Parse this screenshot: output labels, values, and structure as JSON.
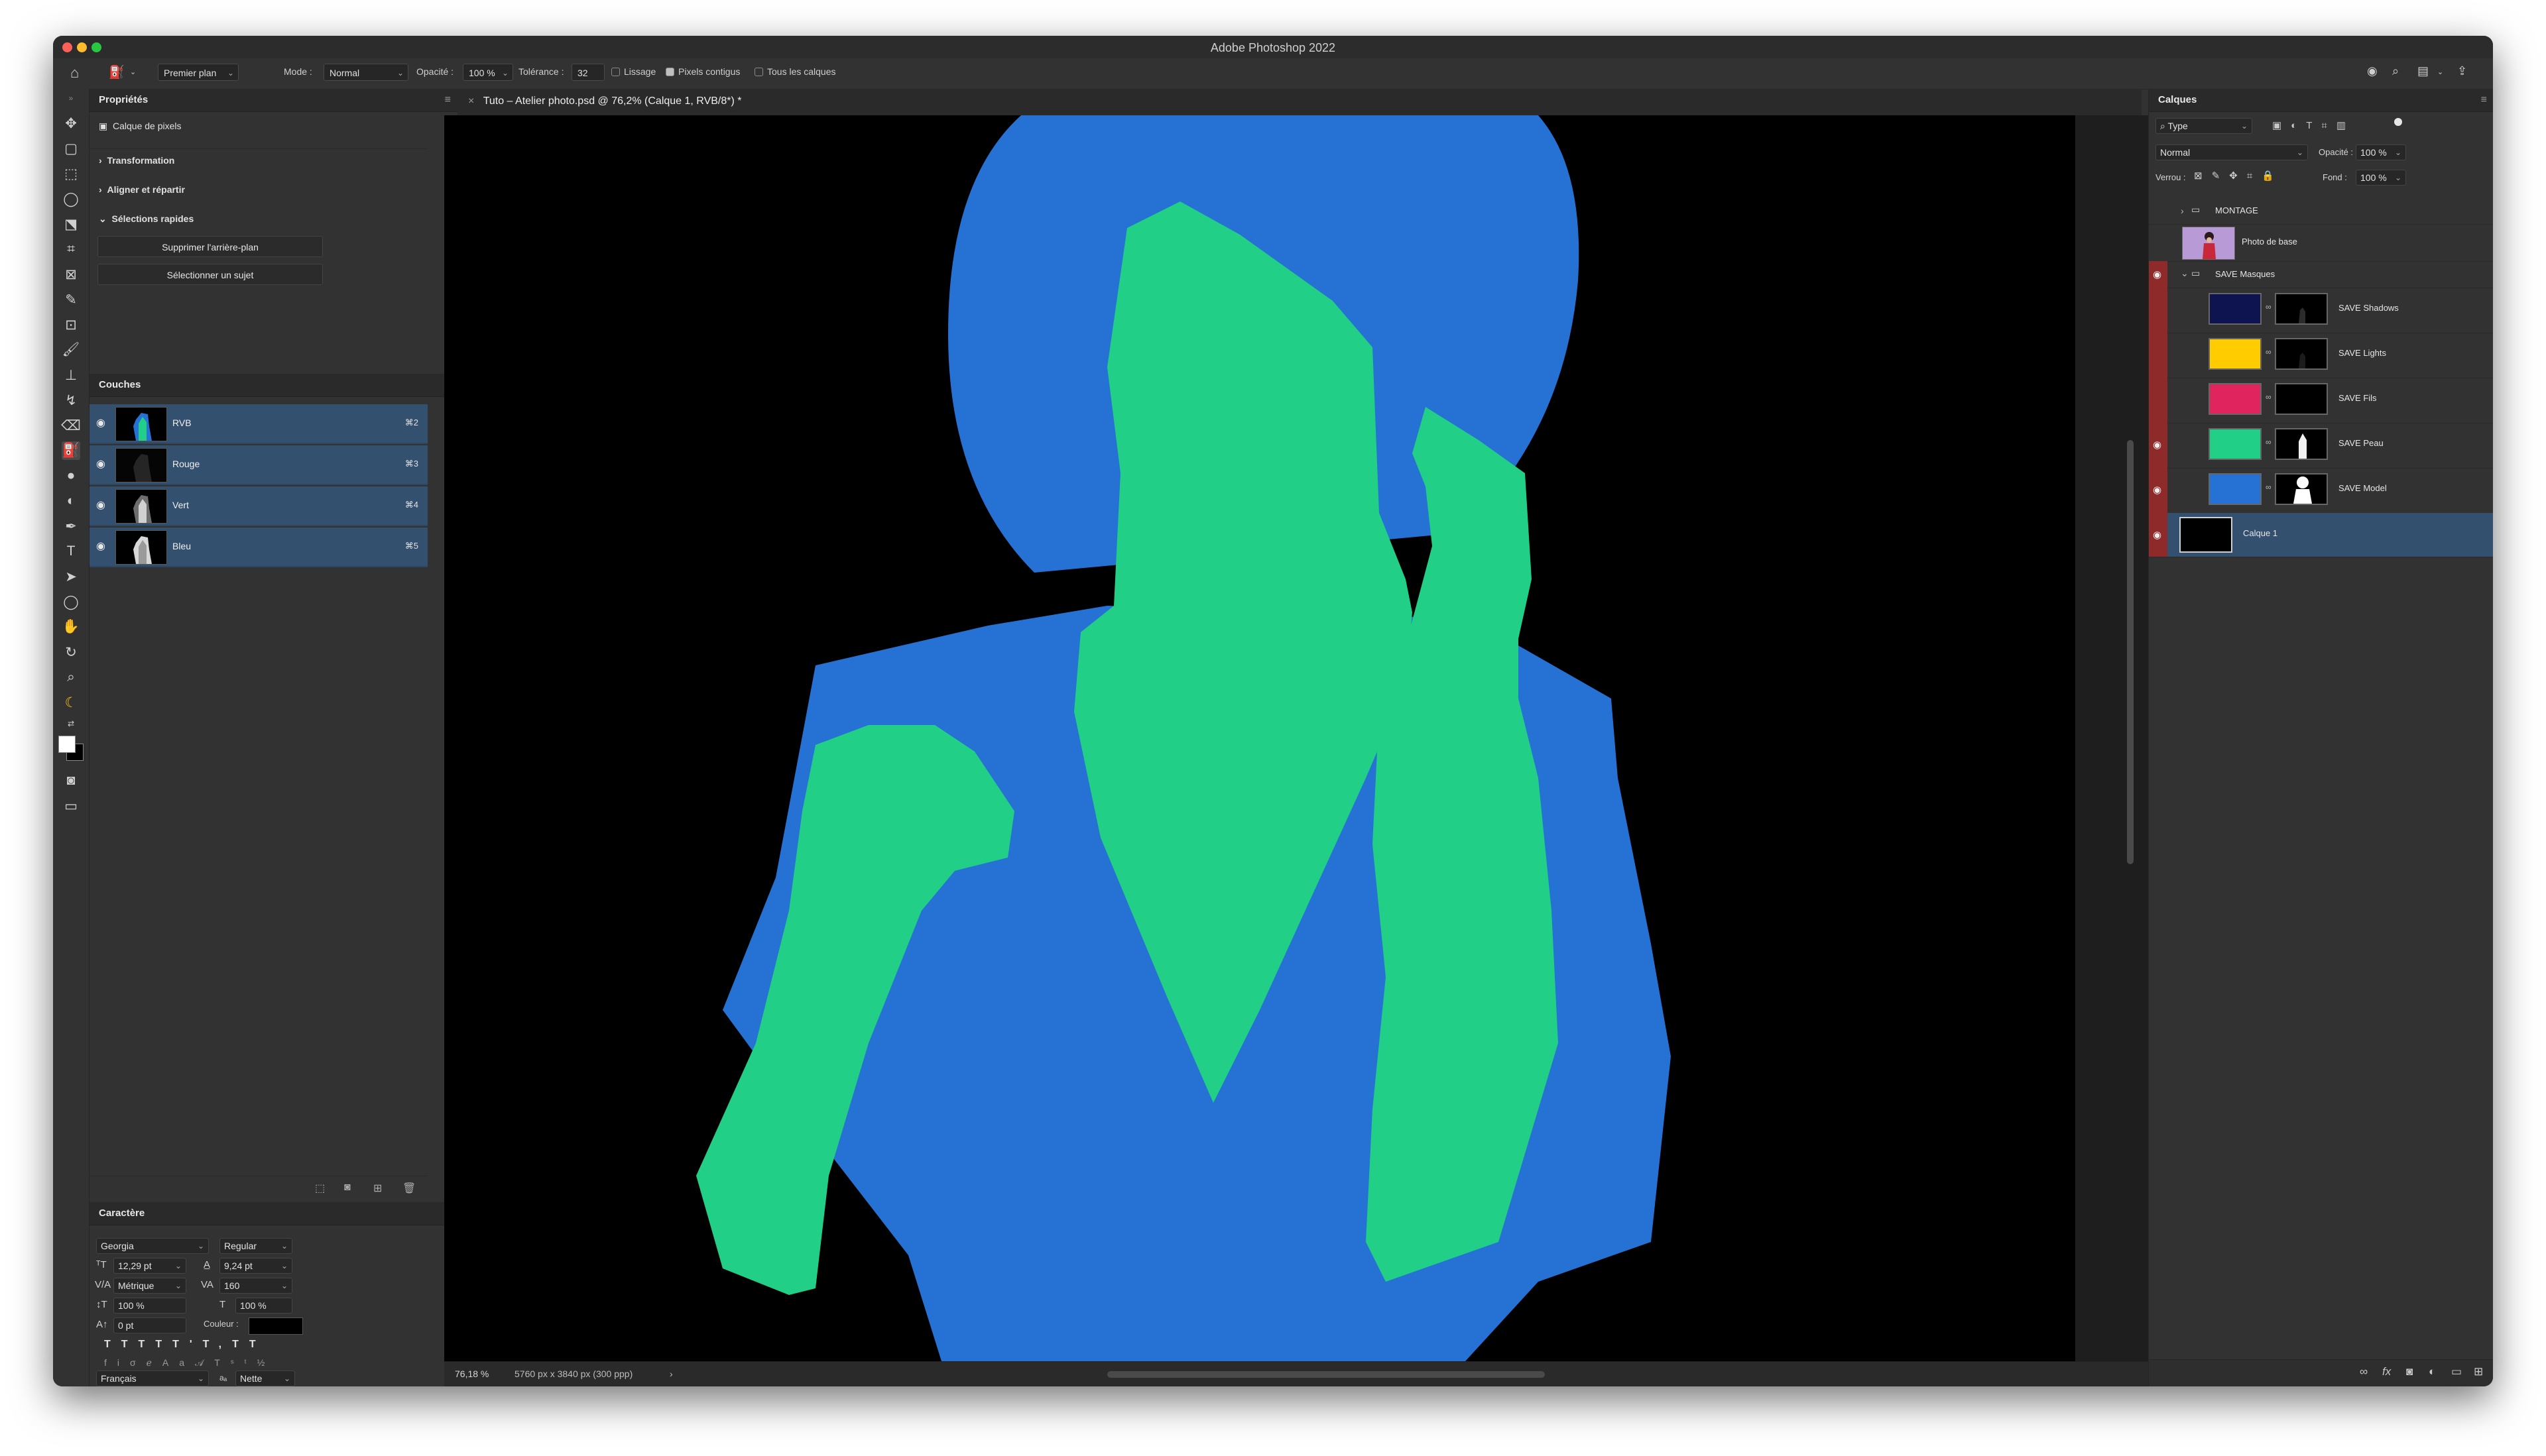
{
  "app": {
    "title": "Adobe Photoshop 2022"
  },
  "options": {
    "preset": "Premier plan",
    "mode_label": "Mode :",
    "mode_value": "Normal",
    "opacity_label": "Opacité :",
    "opacity_value": "100 %",
    "tolerance_label": "Tolérance :",
    "tolerance_value": "32",
    "antialias": "Lissage",
    "contiguous": "Pixels contigus",
    "all_layers": "Tous les calques"
  },
  "properties": {
    "title": "Propriétés",
    "kind": "Calque de pixels",
    "sections": [
      "Transformation",
      "Aligner et répartir",
      "Sélections rapides"
    ],
    "buttons": [
      "Supprimer l'arrière-plan",
      "Sélectionner un sujet"
    ]
  },
  "channels": {
    "title": "Couches",
    "items": [
      {
        "name": "RVB",
        "shortcut": "⌘2"
      },
      {
        "name": "Rouge",
        "shortcut": "⌘3"
      },
      {
        "name": "Vert",
        "shortcut": "⌘4"
      },
      {
        "name": "Bleu",
        "shortcut": "⌘5"
      }
    ]
  },
  "character": {
    "title": "Caractère",
    "font": "Georgia",
    "style": "Regular",
    "size": "12,29 pt",
    "leading": "9,24 pt",
    "kerning": "Métrique",
    "tracking": "160",
    "vscale": "100 %",
    "hscale": "100 %",
    "baseline": "0 pt",
    "color_label": "Couleur :",
    "language": "Français",
    "antialias": "Nette"
  },
  "document": {
    "tab": "Tuto – Atelier photo.psd @ 76,2% (Calque 1, RVB/8*) *",
    "zoom": "76,18 %",
    "info": "5760 px x 3840 px (300 ppp)"
  },
  "layers_panel": {
    "title": "Calques",
    "filter": "Type",
    "blend": "Normal",
    "opacity_label": "Opacité :",
    "opacity": "100 %",
    "lock_label": "Verrou :",
    "fill_label": "Fond :",
    "fill": "100 %",
    "layers": [
      {
        "name": "MONTAGE"
      },
      {
        "name": "Photo de base"
      },
      {
        "name": "SAVE Masques"
      },
      {
        "name": "SAVE Shadows",
        "color": "#0d1450"
      },
      {
        "name": "SAVE Lights",
        "color": "#ffcc00"
      },
      {
        "name": "SAVE Fils",
        "color": "#e0245e"
      },
      {
        "name": "SAVE Peau",
        "color": "#21cf86"
      },
      {
        "name": "SAVE Model",
        "color": "#2672d4"
      },
      {
        "name": "Calque 1"
      }
    ]
  },
  "colors": {
    "fill_blue": "#2672d4",
    "fill_green": "#21cf86",
    "selection": "#34506f"
  }
}
